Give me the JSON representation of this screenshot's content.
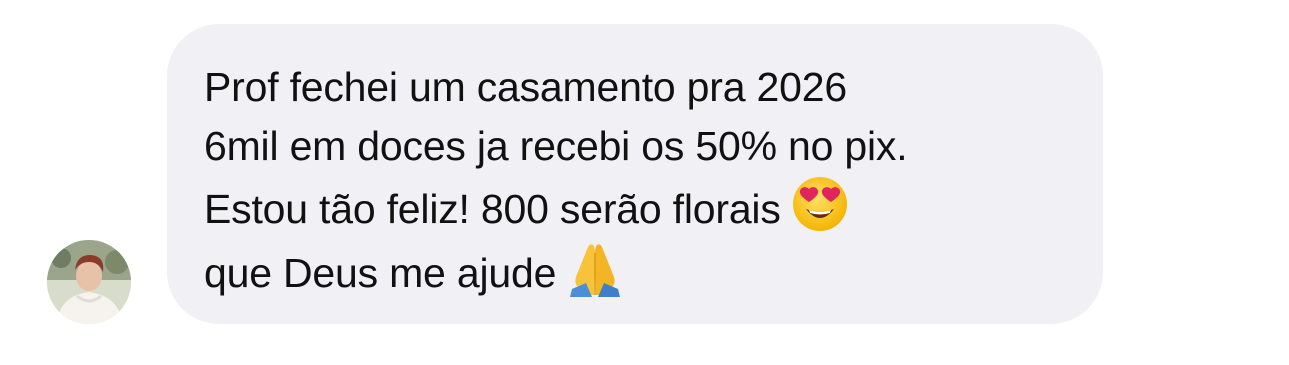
{
  "message": {
    "lines": [
      "Prof fechei um casamento pra 2026",
      "6mil em doces ja recebi os 50% no pix.",
      "Estou tão feliz! 800 serão florais",
      "que Deus me ajude"
    ],
    "emojis": {
      "line3": "heart-eyes-emoji",
      "line4": "folded-hands-emoji"
    }
  },
  "colors": {
    "bubble_background": "#f0f0f5",
    "text": "#111111"
  }
}
